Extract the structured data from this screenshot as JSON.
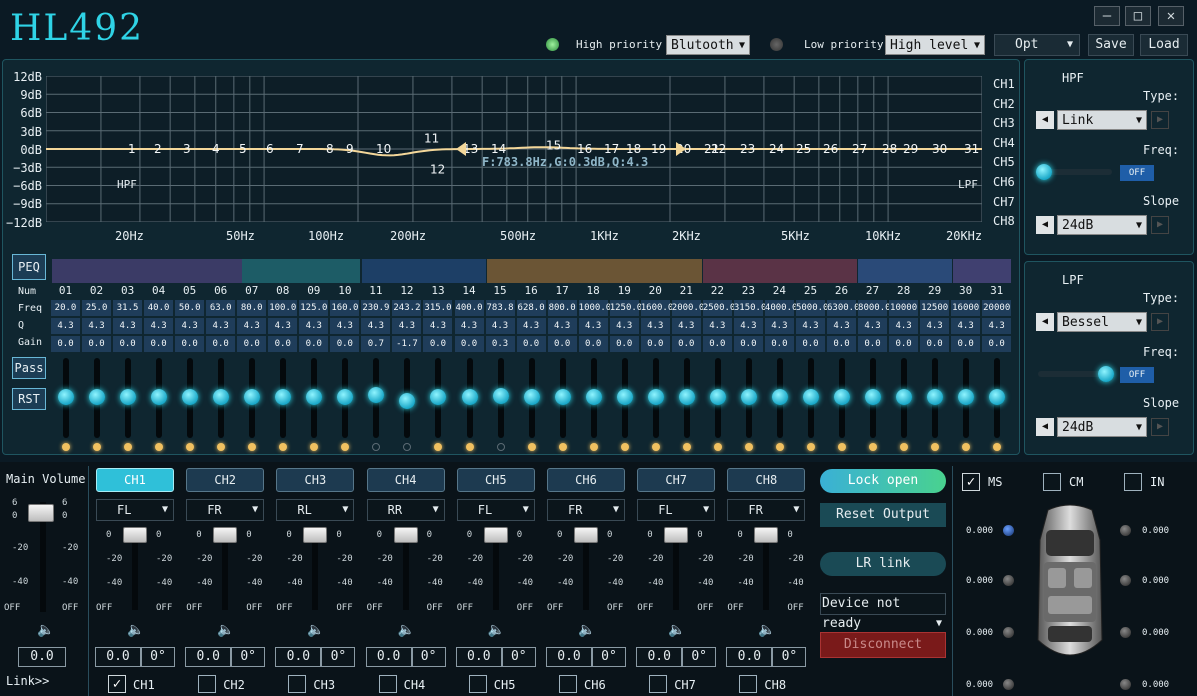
{
  "app": {
    "title": "HL492"
  },
  "window": {
    "minimize": "–",
    "maximize": "□",
    "close": "✕"
  },
  "top": {
    "high_priority_label": "High priority",
    "high_priority_value": "Blutooth",
    "low_priority_label": "Low priority",
    "low_priority_value": "High level",
    "opt": "Opt",
    "save": "Save",
    "load": "Load"
  },
  "graph": {
    "y_ticks": [
      "12dB",
      "9dB",
      "6dB",
      "3dB",
      "0dB",
      "−3dB",
      "−6dB",
      "−9dB",
      "−12dB"
    ],
    "x_ticks": [
      "20Hz",
      "50Hz",
      "100Hz",
      "200Hz",
      "500Hz",
      "1KHz",
      "2KHz",
      "5KHz",
      "10KHz",
      "20KHz"
    ],
    "hpf": "HPF",
    "lpf": "LPF",
    "readout": "F:783.8Hz,G:0.3dB,Q:4.3",
    "channels": [
      "CH1",
      "CH2",
      "CH3",
      "CH4",
      "CH5",
      "CH6",
      "CH7",
      "CH8"
    ]
  },
  "eq": {
    "peq": "PEQ",
    "pass": "Pass",
    "rst": "RST",
    "num_label": "Num",
    "freq_label": "Freq",
    "q_label": "Q",
    "gain_label": "Gain",
    "nums": [
      "01",
      "02",
      "03",
      "04",
      "05",
      "06",
      "07",
      "08",
      "09",
      "10",
      "11",
      "12",
      "13",
      "14",
      "15",
      "16",
      "17",
      "18",
      "19",
      "20",
      "21",
      "22",
      "23",
      "24",
      "25",
      "26",
      "27",
      "28",
      "29",
      "30",
      "31"
    ],
    "freqs": [
      "20.0",
      "25.0",
      "31.5",
      "40.0",
      "50.0",
      "63.0",
      "80.0",
      "100.0",
      "125.0",
      "160.0",
      "230.9",
      "243.2",
      "315.0",
      "400.0",
      "783.8",
      "628.0",
      "800.0",
      "1000.0",
      "1250.0",
      "1600.0",
      "2000.0",
      "2500.0",
      "3150.0",
      "4000.0",
      "5000.0",
      "6300.0",
      "8000.0",
      "10000",
      "12500",
      "16000",
      "20000"
    ],
    "qs": [
      "4.3",
      "4.3",
      "4.3",
      "4.3",
      "4.3",
      "4.3",
      "4.3",
      "4.3",
      "4.3",
      "4.3",
      "4.3",
      "4.3",
      "4.3",
      "4.3",
      "4.3",
      "4.3",
      "4.3",
      "4.3",
      "4.3",
      "4.3",
      "4.3",
      "4.3",
      "4.3",
      "4.3",
      "4.3",
      "4.3",
      "4.3",
      "4.3",
      "4.3",
      "4.3",
      "4.3"
    ],
    "gains": [
      "0.0",
      "0.0",
      "0.0",
      "0.0",
      "0.0",
      "0.0",
      "0.0",
      "0.0",
      "0.0",
      "0.0",
      "0.7",
      "-1.7",
      "0.0",
      "0.0",
      "0.3",
      "0.0",
      "0.0",
      "0.0",
      "0.0",
      "0.0",
      "0.0",
      "0.0",
      "0.0",
      "0.0",
      "0.0",
      "0.0",
      "0.0",
      "0.0",
      "0.0",
      "0.0",
      "0.0"
    ],
    "gain_values": [
      0,
      0,
      0,
      0,
      0,
      0,
      0,
      0,
      0,
      0,
      0.7,
      -1.7,
      0,
      0,
      0.3,
      0,
      0,
      0,
      0,
      0,
      0,
      0,
      0,
      0,
      0,
      0,
      0,
      0,
      0,
      0,
      0
    ],
    "band_enabled": [
      true,
      true,
      true,
      true,
      true,
      true,
      true,
      true,
      true,
      true,
      false,
      false,
      true,
      true,
      false,
      true,
      true,
      true,
      true,
      true,
      true,
      true,
      true,
      true,
      true,
      true,
      true,
      true,
      true,
      true,
      true
    ],
    "curve_labels": [
      "1",
      "2",
      "3",
      "4",
      "5",
      "6",
      "7",
      "8",
      "9",
      "10",
      "11",
      "12",
      "13",
      "14",
      "15",
      "16",
      "17",
      "18",
      "19",
      "20",
      "21",
      "22",
      "23",
      "24",
      "25",
      "26",
      "27",
      "28",
      "29",
      "30",
      "31"
    ],
    "segment_colors": [
      "#3b3b66",
      "#1d5c66",
      "#1d3f66",
      "#6b5535",
      "#5a3346",
      "#2a4a78",
      "#404070"
    ]
  },
  "hpf_panel": {
    "title": "HPF",
    "type_label": "Type:",
    "type": "Link",
    "freq_label": "Freq:",
    "toggle": "OFF",
    "slope_label": "Slope",
    "slope": "24dB",
    "freq_position": 0.0
  },
  "lpf_panel": {
    "title": "LPF",
    "type_label": "Type:",
    "type": "Bessel",
    "freq_label": "Freq:",
    "toggle": "OFF",
    "slope_label": "Slope",
    "slope": "24dB",
    "freq_position": 1.0
  },
  "main_volume": {
    "label": "Main Volume",
    "scale_left": [
      "6",
      "0",
      "-20",
      "-40",
      "OFF"
    ],
    "scale_right": [
      "6",
      "0",
      "-20",
      "-40",
      "OFF"
    ],
    "value": "0.0"
  },
  "channels": [
    {
      "tab": "CH1",
      "position": "FL",
      "vol": "0.0",
      "phase": "0°",
      "check": "CH1",
      "checked": true,
      "active": true
    },
    {
      "tab": "CH2",
      "position": "FR",
      "vol": "0.0",
      "phase": "0°",
      "check": "CH2",
      "checked": false,
      "active": false
    },
    {
      "tab": "CH3",
      "position": "RL",
      "vol": "0.0",
      "phase": "0°",
      "check": "CH3",
      "checked": false,
      "active": false
    },
    {
      "tab": "CH4",
      "position": "RR",
      "vol": "0.0",
      "phase": "0°",
      "check": "CH4",
      "checked": false,
      "active": false
    },
    {
      "tab": "CH5",
      "position": "FL",
      "vol": "0.0",
      "phase": "0°",
      "check": "CH5",
      "checked": false,
      "active": false
    },
    {
      "tab": "CH6",
      "position": "FR",
      "vol": "0.0",
      "phase": "0°",
      "check": "CH6",
      "checked": false,
      "active": false
    },
    {
      "tab": "CH7",
      "position": "FL",
      "vol": "0.0",
      "phase": "0°",
      "check": "CH7",
      "checked": false,
      "active": false
    },
    {
      "tab": "CH8",
      "position": "FR",
      "vol": "0.0",
      "phase": "0°",
      "check": "CH8",
      "checked": false,
      "active": false
    }
  ],
  "channel_scale": {
    "left": [
      "0",
      "-20",
      "-40",
      "OFF"
    ],
    "right": [
      "0",
      "-20",
      "-40",
      "OFF"
    ]
  },
  "controls": {
    "lock": "Lock open",
    "reset": "Reset Output",
    "lr_link": "LR link",
    "device": "Device not ready",
    "disconnect": "Disconnect"
  },
  "mode": {
    "ms": "MS",
    "cm": "CM",
    "in": "IN",
    "ms_checked": true
  },
  "delays": {
    "left": [
      "0.000",
      "0.000",
      "0.000",
      "0.000"
    ],
    "right": [
      "0.000",
      "0.000",
      "0.000",
      "0.000"
    ]
  },
  "link": "Link>>",
  "colors": {
    "accent": "#2fd3e6",
    "knob": "#2fd3e6",
    "dot_on": "#f0c060",
    "disconnect": "#7a1a1a"
  }
}
